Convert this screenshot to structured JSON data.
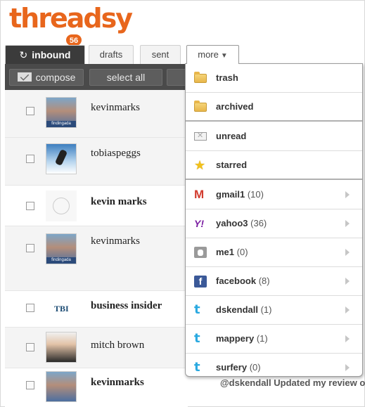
{
  "app": {
    "logo": "threadsy",
    "badge_count": "56"
  },
  "tabs": {
    "inbound": "inbound",
    "drafts": "drafts",
    "sent": "sent",
    "more": "more"
  },
  "toolbar": {
    "compose": "compose",
    "select_all": "select all"
  },
  "messages": [
    {
      "sender": "kevinmarks",
      "avatar_tag": "findingada"
    },
    {
      "sender": "tobiaspeggs"
    },
    {
      "sender": "kevin marks"
    },
    {
      "sender": "kevinmarks",
      "avatar_tag": "findingada"
    },
    {
      "sender": "business insider",
      "avatar_text": "TBI"
    },
    {
      "sender": "mitch brown"
    },
    {
      "sender": "kevinmarks"
    }
  ],
  "preview_text": "@dskendall Updated my review on",
  "more_menu": [
    {
      "label": "trash",
      "icon": "folder-icon"
    },
    {
      "label": "archived",
      "icon": "folder-icon"
    },
    {
      "label": "unread",
      "icon": "envelope-icon"
    },
    {
      "label": "starred",
      "icon": "star-icon"
    },
    {
      "label": "gmail1",
      "count": "(10)",
      "icon": "gmail-icon",
      "glyph": "M"
    },
    {
      "label": "yahoo3",
      "count": "(36)",
      "icon": "yahoo-icon",
      "glyph": "Y!"
    },
    {
      "label": "me1",
      "count": "(0)",
      "icon": "me-icon"
    },
    {
      "label": "facebook",
      "count": "(8)",
      "icon": "facebook-icon",
      "glyph": "f"
    },
    {
      "label": "dskendall",
      "count": "(1)",
      "icon": "twitter-icon",
      "glyph": "t"
    },
    {
      "label": "mappery",
      "count": "(1)",
      "icon": "twitter-icon",
      "glyph": "t"
    },
    {
      "label": "surfery",
      "count": "(0)",
      "icon": "twitter-icon",
      "glyph": "t"
    }
  ]
}
